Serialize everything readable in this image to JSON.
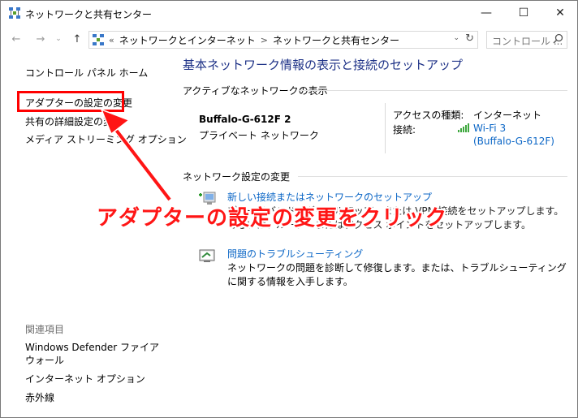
{
  "window": {
    "title": "ネットワークと共有センター",
    "min": "—",
    "max": "☐",
    "close": "✕"
  },
  "nav": {
    "back": "←",
    "forward": "→",
    "dropdown": "⌄",
    "up": "↑",
    "address": {
      "chevron": "«",
      "part1": "ネットワークとインターネット",
      "sep": ">",
      "part2": "ネットワークと共有センター",
      "dd": "⌄",
      "refresh": "↻"
    },
    "search_placeholder": "コントロール ..."
  },
  "sidebar": {
    "items": [
      {
        "label": "コントロール パネル ホーム"
      },
      {
        "label": "アダプターの設定の変更"
      },
      {
        "label": "共有の詳細設定の変更"
      },
      {
        "label": "メディア ストリーミング オプション"
      }
    ],
    "related_heading": "関連項目",
    "related": [
      {
        "label": "Windows Defender ファイアウォール"
      },
      {
        "label": "インターネット オプション"
      },
      {
        "label": "赤外線"
      }
    ]
  },
  "main": {
    "title": "基本ネットワーク情報の表示と接続のセットアップ",
    "active_heading": "アクティブなネットワークの表示",
    "network": {
      "name": "Buffalo-G-612F 2",
      "type": "プライベート ネットワーク",
      "access_label": "アクセスの種類:",
      "access_value": "インターネット",
      "connection_label": "接続:",
      "connection_value_line1": "Wi-Fi 3",
      "connection_value_line2": "(Buffalo-G-612F)"
    },
    "settings_heading": "ネットワーク設定の変更",
    "tasks": [
      {
        "title": "新しい接続またはネットワークのセットアップ",
        "desc": "ブロードバンド、ダイヤルアップ、または VPN 接続をセットアップします。あるいは、ルーターまたはアクセス ポイントをセットアップします。"
      },
      {
        "title": "問題のトラブルシューティング",
        "desc": "ネットワークの問題を診断して修復します。または、トラブルシューティングに関する情報を入手します。"
      }
    ]
  },
  "annotation": {
    "text": "アダプターの設定の変更をクリック"
  },
  "colors": {
    "link": "#0b66c6",
    "title": "#1e3287",
    "annotation": "#ff0000"
  }
}
